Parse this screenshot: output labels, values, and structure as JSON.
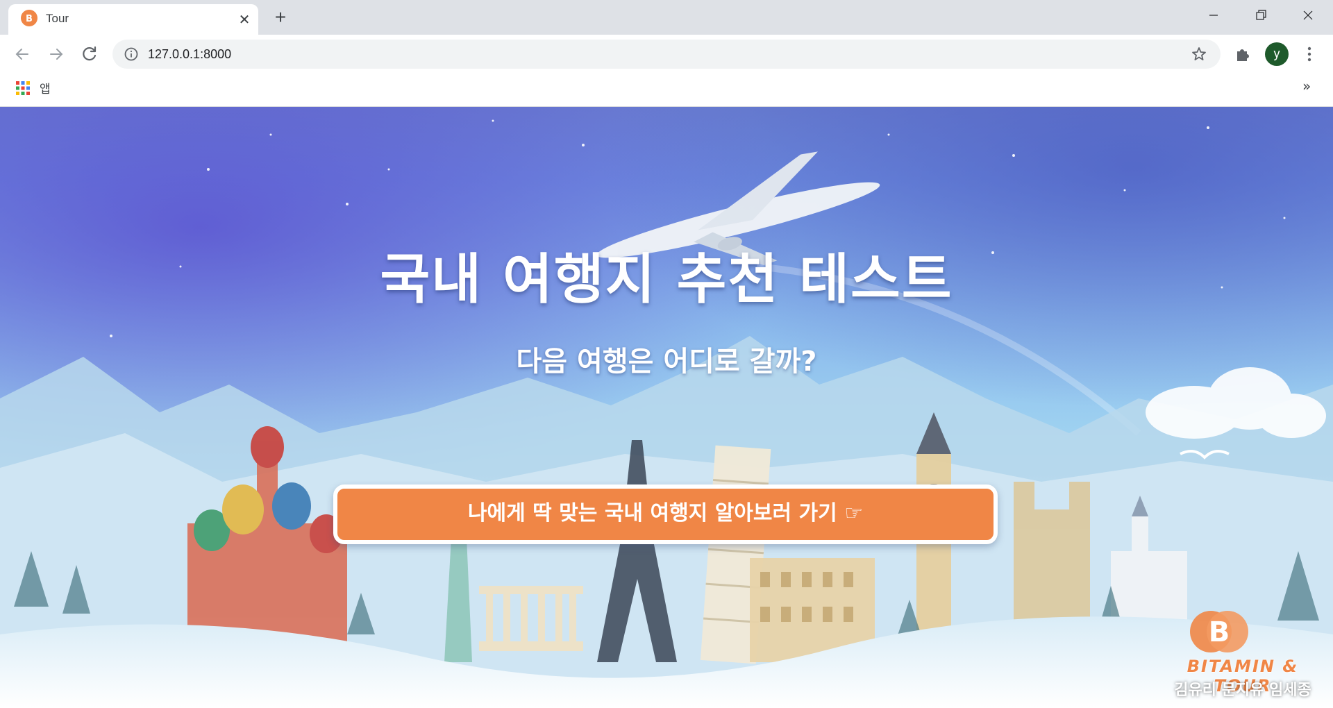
{
  "browser": {
    "tab_title": "Tour",
    "url": "127.0.0.1:8000",
    "profile_initial": "y",
    "bookmarks_apps_label": "앱",
    "bookmarks_overflow": "»"
  },
  "page": {
    "title": "국내 여행지 추천 테스트",
    "subtitle": "다음 여행은 어디로 갈까?",
    "cta_label": "나에게 딱 맞는 국내 여행지 알아보러 가기 ☞",
    "brand_name": "BITAMIN & TOUR",
    "brand_members": "김유리 문지유 임세종"
  },
  "colors": {
    "accent": "#f08646",
    "avatar": "#1e5a2b"
  },
  "icons": {
    "favicon": "bb-logo-icon",
    "back": "arrow-left-icon",
    "forward": "arrow-right-icon",
    "reload": "reload-icon",
    "site_info": "info-icon",
    "bookmark": "star-icon",
    "extensions": "puzzle-icon",
    "menu": "kebab-menu-icon",
    "apps": "apps-grid-icon"
  }
}
